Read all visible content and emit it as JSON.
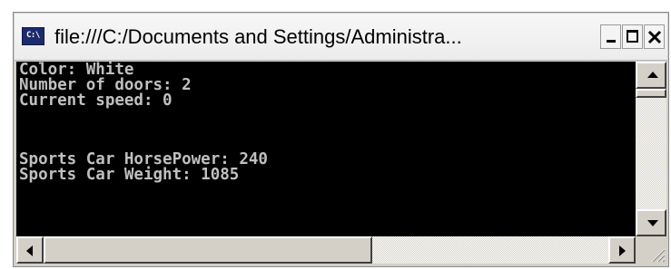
{
  "window": {
    "title": "file:///C:/Documents and Settings/Administra...",
    "icon_label": "C:\\"
  },
  "caption_buttons": {
    "minimize_icon": "minimize-icon",
    "maximize_icon": "maximize-icon",
    "close_icon": "close-icon"
  },
  "console": {
    "lines": [
      "Color: White",
      "Number of doors: 2",
      "Current speed: 0",
      "",
      "Sports Car HorsePower: 240",
      "Sports Car Weight: 1085"
    ],
    "colors": {
      "background": "#000000",
      "text": "#c0c0c0"
    }
  },
  "scrollbars": {
    "vertical": {
      "up_icon": "arrow-up-icon",
      "down_icon": "arrow-down-icon"
    },
    "horizontal": {
      "left_icon": "arrow-left-icon",
      "right_icon": "arrow-right-icon"
    }
  }
}
